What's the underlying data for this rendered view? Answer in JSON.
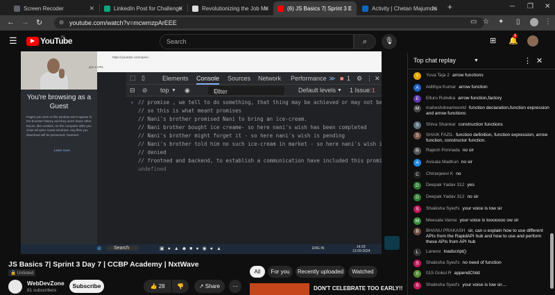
{
  "browser": {
    "tabs": [
      {
        "label": "Screen Recoder",
        "color": "#5f6368",
        "active": false
      },
      {
        "label": "LinkedIn Post for Challenge",
        "color": "#10a37f",
        "active": false
      },
      {
        "label": "Revolutionizing the Job Market",
        "color": "#dddddd",
        "active": false
      },
      {
        "label": "(6) JS Basics 7| Sprint 3 Day",
        "color": "#ff0000",
        "active": true
      },
      {
        "label": "Activity | Chetan Majumdar | Lin",
        "color": "#0a66c2",
        "active": false
      }
    ],
    "url": "youtube.com/watch?v=mcwmzpArEEE"
  },
  "youtube": {
    "logo": "YouTube",
    "region": "IN",
    "search_placeholder": "Search",
    "notif_count": "6"
  },
  "video": {
    "guest_title": "You're browsing as a Guest",
    "guest_text": "Pages you view in this window won't appear in the browser history and they won't leave other traces, like cookies, on the computer after you close all open Guest windows. Any files you download will be preserved, however.",
    "guest_link": "Learn more",
    "inner_url": "https://youtube.com/open/..",
    "inner_search": "ype a URL",
    "devtools_tabs": [
      "Elements",
      "Console",
      "Sources",
      "Network",
      "Performance"
    ],
    "devtools_active": "Console",
    "errors": "1",
    "context": "top",
    "filter_placeholder": "Filter",
    "levels": "Default levels",
    "issues": "1 Issue:",
    "issue_count": "1",
    "console_lines": [
      "// promise , we tell to do something, that thing may be achieved or may not be?",
      "// so this is what meant promises",
      "// Nani's brother promised Nani to bring an ice-cream.",
      "// Nani brother bought ice creame- so here nani's wish has been completed",
      "// Nani's brother might forget it - so here nani's wish is pending",
      "// Nani's brother told him no such ice-cream in market - so here nani's wish is",
      "// denied",
      "// frontned and backend, to establish a communication have included this promises"
    ],
    "undefined_text": "undefined",
    "taskbar_search": "Search",
    "taskbar_lang": "ENG IN",
    "taskbar_time": "14:29",
    "taskbar_date": "13-09-2024"
  },
  "info": {
    "title": "JS Basics 7| Sprint 3 Day 7 | CCBP Academy | NxtWave",
    "unlisted": "Unlisted",
    "channel": "WebDevZone",
    "subscribers": "81 subscribers",
    "subscribe": "Subscribe",
    "likes": "28",
    "share": "Share",
    "chips": [
      "All",
      "For you",
      "Recently uploaded",
      "Watched"
    ],
    "reco_title": "DON'T CELEBRATE TOO EARLY!!"
  },
  "chat": {
    "title": "Top chat replay",
    "messages": [
      {
        "author": "Yuva Teja 2",
        "text": "arrow functions",
        "initial": "Y",
        "color": "#e2a400"
      },
      {
        "author": "Adithya Kumar",
        "text": "arrow function",
        "initial": "A",
        "color": "#1e63c8"
      },
      {
        "author": "Elluru Rutwika",
        "text": "arrow function,factory",
        "initial": "E",
        "color": "#5e35b1"
      },
      {
        "author": "maheshdreamworld",
        "text": "function declaration,function expression and arrow functions",
        "initial": "M",
        "color": "#444444"
      },
      {
        "author": "Shiva Shankar",
        "text": "construction functions",
        "initial": "S",
        "color": "#607080"
      },
      {
        "author": "SHAIK FAZIL",
        "text": "function definition, function expression, arrow function, constructor function.",
        "initial": "S",
        "color": "#795548"
      },
      {
        "author": "Rajesh Ponnada",
        "text": "no sir",
        "initial": "R",
        "color": "#555555"
      },
      {
        "author": "Avisala Madhuri",
        "text": "no sir",
        "initial": "A",
        "color": "#1e88e5"
      },
      {
        "author": "Chiranjeevi K",
        "text": "no",
        "initial": "C",
        "color": "#222222"
      },
      {
        "author": "Deepak Yadav 312",
        "text": "yes",
        "initial": "D",
        "color": "#2e7d32"
      },
      {
        "author": "Deepak Yadav 312",
        "text": "no sir",
        "initial": "D",
        "color": "#2e7d32"
      },
      {
        "author": "Shaiksha Syed's",
        "text": "your voice is low sir",
        "initial": "S",
        "color": "#c2185b"
      },
      {
        "author": "Meesala Vamsi",
        "text": "your voice is tooooooo ow sir",
        "initial": "M",
        "color": "#388e3c"
      },
      {
        "author": "BHANU PRAKASH",
        "text": "sir, can u explain how to use different APIs from the RapidAPI hub and how to use and perform these APIs from API hub",
        "initial": "B",
        "color": "#6d4c41"
      },
      {
        "author": "Laneox",
        "text": "loadscript()",
        "initial": "L",
        "color": "#333333"
      },
      {
        "author": "Shaiksha Syed's",
        "text": "no need of function",
        "initial": "S",
        "color": "#c2185b"
      },
      {
        "author": "015 Gokul R",
        "text": "appendChild",
        "initial": "0",
        "color": "#558b2f"
      },
      {
        "author": "Shaiksha Syed's",
        "text": "your voice is low sir....",
        "initial": "S",
        "color": "#c2185b"
      }
    ]
  }
}
